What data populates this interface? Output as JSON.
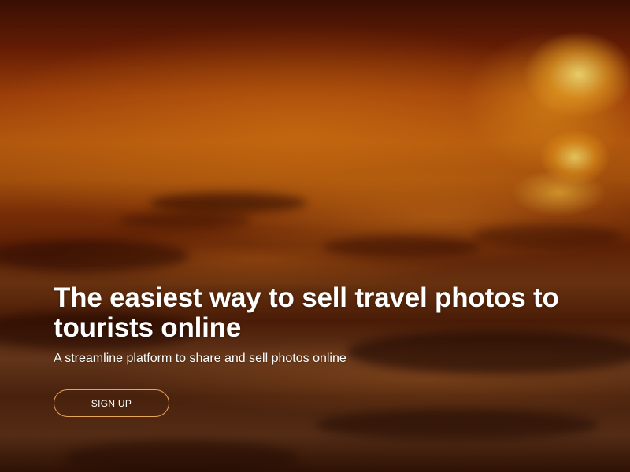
{
  "hero": {
    "headline": "The easiest way to sell travel photos to tourists online",
    "subheadline": "A streamline platform to share and sell photos online",
    "cta_label": "SIGN UP",
    "background": "sunset-water-reflection-image"
  },
  "colors": {
    "text": "#ffffff",
    "button_border": "#e8a45a",
    "background_primary": "#c4600f",
    "background_dark": "#3b0f03"
  }
}
